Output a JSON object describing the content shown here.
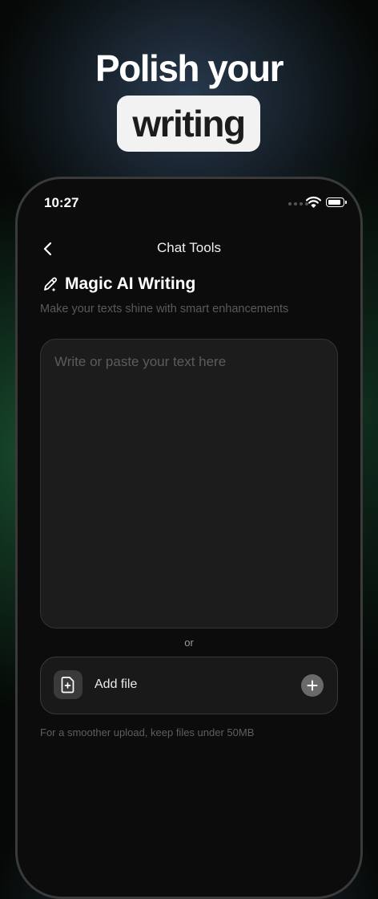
{
  "promo": {
    "headline": "Polish your",
    "highlight": "writing"
  },
  "status_bar": {
    "time": "10:27"
  },
  "nav": {
    "title": "Chat Tools"
  },
  "tool": {
    "title": "Magic AI Writing",
    "subtitle": "Make your texts shine with smart enhancements"
  },
  "editor": {
    "value": "",
    "placeholder": "Write or paste your text here"
  },
  "divider": {
    "label": "or"
  },
  "upload": {
    "label": "Add file",
    "hint": "For a smoother upload, keep files under 50MB"
  },
  "icons": {
    "back": "chevron-left-icon",
    "tool": "pen-sparkle-icon",
    "file": "file-plus-icon",
    "add": "plus-icon",
    "wifi": "wifi-icon",
    "battery": "battery-icon"
  },
  "colors": {
    "background": "#050806",
    "screen": "#0c0c0c",
    "card": "#1c1c1c",
    "pill": "#f2f2f2",
    "muted_text": "#5a5a5a"
  }
}
